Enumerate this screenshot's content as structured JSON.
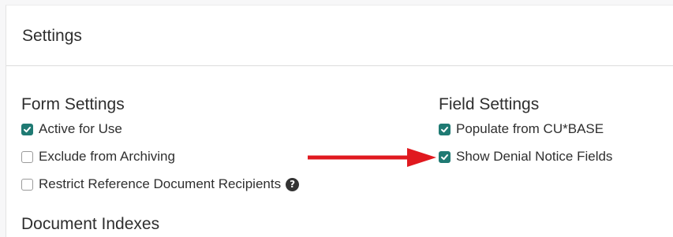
{
  "panel": {
    "title": "Settings"
  },
  "form_settings": {
    "heading": "Form Settings",
    "items": [
      {
        "label": "Active for Use",
        "checked": true
      },
      {
        "label": "Exclude from Archiving",
        "checked": false
      },
      {
        "label": "Restrict Reference Document Recipients",
        "checked": false,
        "help_icon": "question-circle-icon",
        "help_glyph": "?"
      }
    ]
  },
  "field_settings": {
    "heading": "Field Settings",
    "items": [
      {
        "label": "Populate from CU*BASE",
        "checked": true
      },
      {
        "label": "Show Denial Notice Fields",
        "checked": true
      }
    ]
  },
  "document_indexes": {
    "heading": "Document Indexes"
  },
  "annotation": {
    "arrow_icon": "red-arrow-right-icon",
    "arrow_color": "#e0191f"
  },
  "colors": {
    "checkbox_checked": "#1f7a73",
    "text": "#2f2f2f"
  }
}
